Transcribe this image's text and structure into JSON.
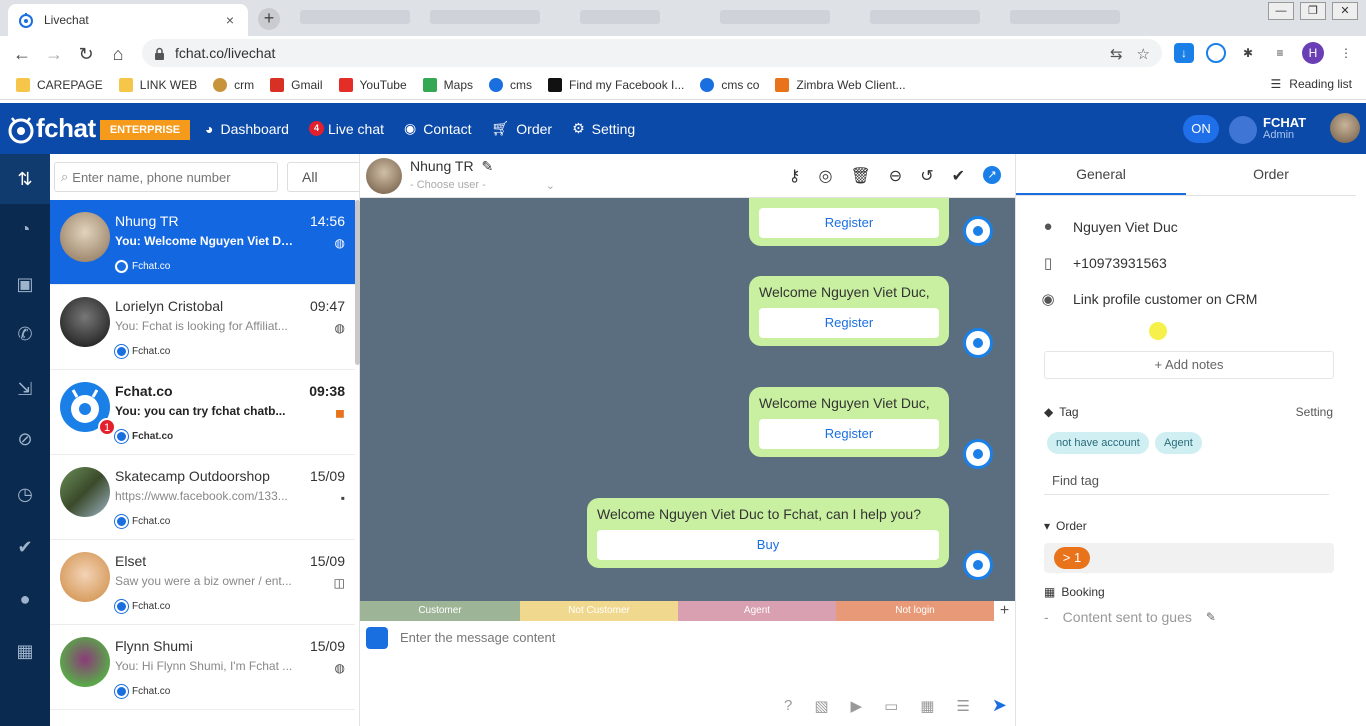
{
  "browser": {
    "tab_title": "Livechat",
    "tab_close": "×",
    "new_tab": "+",
    "url": "fchat.co/livechat",
    "bookmarks": [
      {
        "label": "CAREPAGE",
        "color": "#f6c64a"
      },
      {
        "label": "LINK WEB",
        "color": "#f6c64a"
      },
      {
        "label": "crm",
        "color": "#c8943a"
      },
      {
        "label": "Gmail",
        "color": "#d93025"
      },
      {
        "label": "YouTube",
        "color": "#e52d27"
      },
      {
        "label": "Maps",
        "color": "#34a853"
      },
      {
        "label": "cms",
        "color": "#1a6fe0"
      },
      {
        "label": "Find my Facebook I...",
        "color": "#111111"
      },
      {
        "label": "cms co",
        "color": "#1a6fe0"
      },
      {
        "label": "Zimbra Web Client...",
        "color": "#e8731b"
      }
    ],
    "reading_list": "Reading list",
    "profile_initial": "H"
  },
  "app": {
    "logo": "fchat",
    "edition": "ENTERPRISE",
    "nav": [
      {
        "label": "Dashboard",
        "icon": "dashboard-icon"
      },
      {
        "label": "Live chat",
        "icon": "live-chat-icon",
        "badge": "4"
      },
      {
        "label": "Contact",
        "icon": "contact-icon"
      },
      {
        "label": "Order",
        "icon": "cart-icon"
      },
      {
        "label": "Setting",
        "icon": "gear-icon"
      }
    ],
    "status_toggle": "ON",
    "account_name": "FCHAT",
    "account_role": "Admin",
    "accent": "#0b4aa8"
  },
  "conversations": {
    "search_placeholder": "Enter name, phone number",
    "filter": "All",
    "items": [
      {
        "name": "Nhung TR",
        "time": "14:56",
        "message": "You: Welcome Nguyen Viet Du...",
        "source": "Fchat.co",
        "channel": "messenger-icon",
        "active": true
      },
      {
        "name": "Lorielyn Cristobal",
        "time": "09:47",
        "message": "You: Fchat is looking for Affiliat...",
        "source": "Fchat.co",
        "channel": "messenger-icon"
      },
      {
        "name": "Fchat.co",
        "time": "09:38",
        "message": "You: you can try fchat chatb...",
        "source": "Fchat.co",
        "channel": "chat-icon",
        "unread": "1",
        "bold": true
      },
      {
        "name": "Skatecamp Outdoorshop",
        "time": "15/09",
        "message": "https://www.facebook.com/133...",
        "source": "Fchat.co",
        "channel": "comment-icon"
      },
      {
        "name": "Elset",
        "time": "15/09",
        "message": "Saw you were a biz owner / ent...",
        "source": "Fchat.co",
        "channel": "instagram-icon"
      },
      {
        "name": "Flynn Shumi",
        "time": "15/09",
        "message": "You: Hi Flynn Shumi, I'm Fchat ...",
        "source": "Fchat.co",
        "channel": "messenger-icon"
      }
    ]
  },
  "chat": {
    "contact_name": "Nhung TR",
    "choose_user": "- Choose user -",
    "messages": [
      {
        "text": "",
        "button": "Register"
      },
      {
        "text": "Welcome Nguyen Viet Duc,",
        "button": "Register"
      },
      {
        "text": "Welcome Nguyen Viet Duc,",
        "button": "Register"
      },
      {
        "text": "Welcome Nguyen Viet Duc to Fchat, can I help you?",
        "button": "Buy"
      }
    ],
    "status_legend": [
      {
        "label": "Customer",
        "color": "#9db596"
      },
      {
        "label": "Not Customer",
        "color": "#f0d98e"
      },
      {
        "label": "Agent",
        "color": "#d8a0b0"
      },
      {
        "label": "Not login",
        "color": "#e89a78"
      }
    ],
    "composer_placeholder": "Enter the message content"
  },
  "details": {
    "tabs": [
      "General",
      "Order"
    ],
    "name": "Nguyen Viet Duc",
    "phone": "+10973931563",
    "crm_link": "Link profile customer on CRM",
    "add_notes": "+ Add notes",
    "tag_label": "Tag",
    "tag_setting": "Setting",
    "tags": [
      "not have account",
      "Agent"
    ],
    "find_tag": "Find tag",
    "order_label": "Order",
    "order_count": "> 1",
    "booking_label": "Booking",
    "booking_dash": "-",
    "booking_placeholder": "Content sent to gues"
  }
}
